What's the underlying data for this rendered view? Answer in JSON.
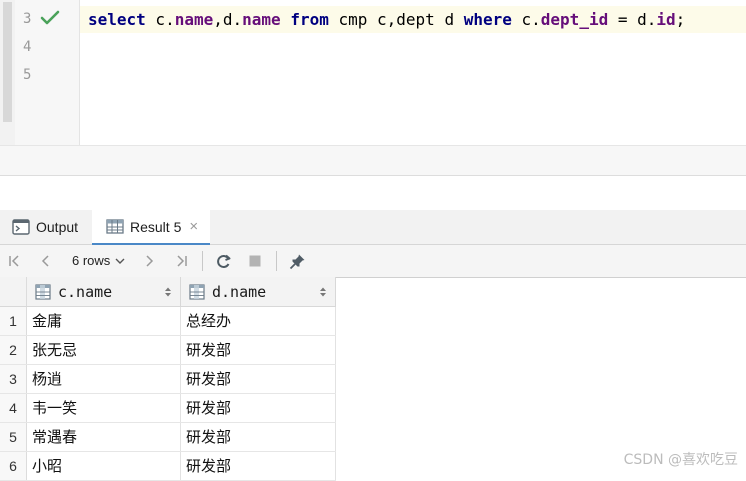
{
  "editor": {
    "lines": [
      {
        "number": "3",
        "has_check": true
      },
      {
        "number": "4",
        "has_check": false
      },
      {
        "number": "5",
        "has_check": false
      }
    ],
    "code": {
      "kw_select": "select",
      "t1": " c.",
      "f_cname": "name",
      "t2": ",d.",
      "f_dname": "name",
      "t3": " ",
      "kw_from": "from",
      "t4": " cmp c,dept d ",
      "kw_where": "where",
      "t5": " c.",
      "f_deptid": "dept_id",
      "t6": " = d.",
      "f_id": "id",
      "t7": ";"
    }
  },
  "tabs": {
    "output": "Output",
    "result": "Result 5",
    "close": "×"
  },
  "toolbar": {
    "rows_label": "6 rows"
  },
  "grid": {
    "columns": [
      "c.name",
      "d.name"
    ],
    "rows": [
      {
        "n": "1",
        "c1": "金庸",
        "c2": "总经办"
      },
      {
        "n": "2",
        "c1": "张无忌",
        "c2": "研发部"
      },
      {
        "n": "3",
        "c1": "杨逍",
        "c2": "研发部"
      },
      {
        "n": "4",
        "c1": "韦一笑",
        "c2": "研发部"
      },
      {
        "n": "5",
        "c1": "常遇春",
        "c2": "研发部"
      },
      {
        "n": "6",
        "c1": "小昭",
        "c2": "研发部"
      }
    ]
  },
  "watermark": "CSDN @喜欢吃豆"
}
